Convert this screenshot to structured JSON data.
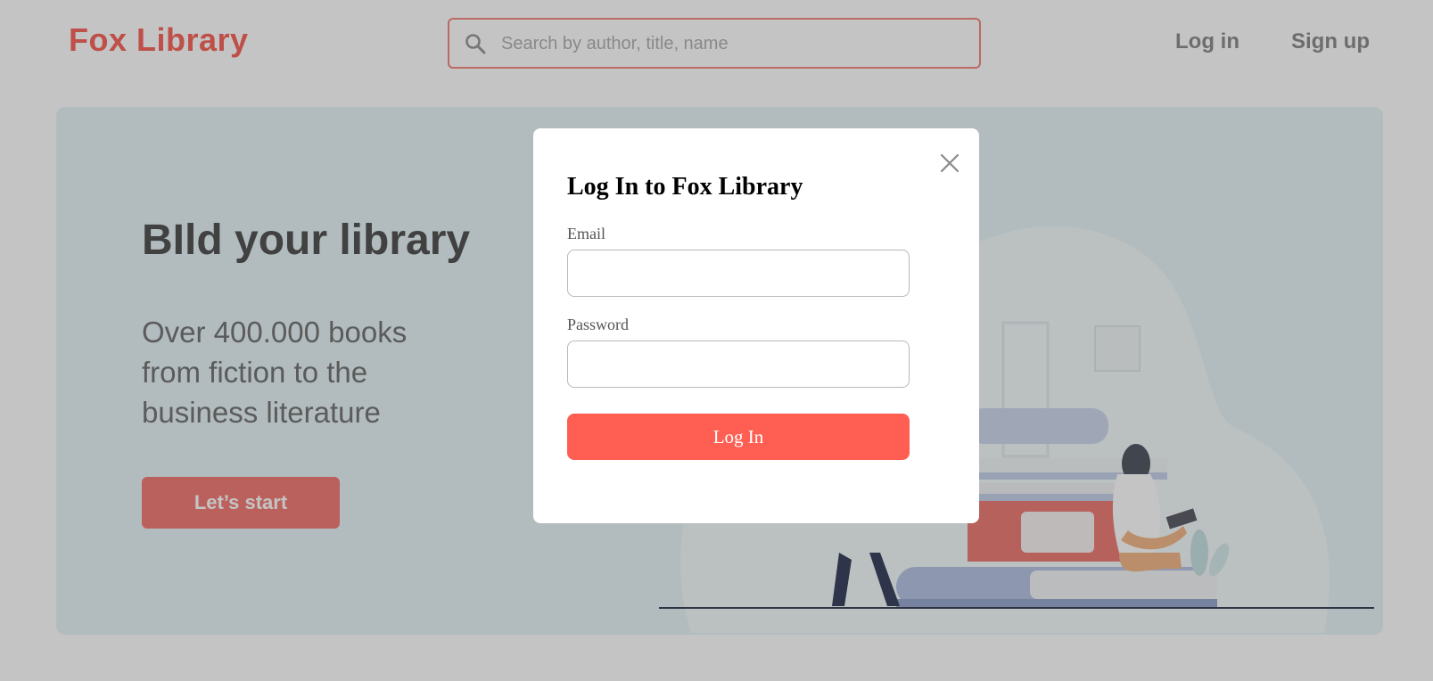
{
  "colors": {
    "brand": "#f7695f",
    "primary_button": "#ff5f52",
    "hero_background": "#e8f5f7"
  },
  "header": {
    "logo": "Fox Library",
    "search": {
      "placeholder": "Search by author, title, name",
      "value": "",
      "icon": "search-icon"
    },
    "nav": {
      "login": "Log in",
      "signup": "Sign up"
    }
  },
  "hero": {
    "title": "BIld your library",
    "subtitle": "Over 400.000 books from fiction to the business literature",
    "cta": "Let’s start",
    "illustration": "people-reading-on-book-stack-illustration"
  },
  "modal": {
    "title": "Log In to Fox Library",
    "close_icon": "close-icon",
    "email": {
      "label": "Email",
      "value": ""
    },
    "password": {
      "label": "Password",
      "value": ""
    },
    "submit": "Log In"
  }
}
